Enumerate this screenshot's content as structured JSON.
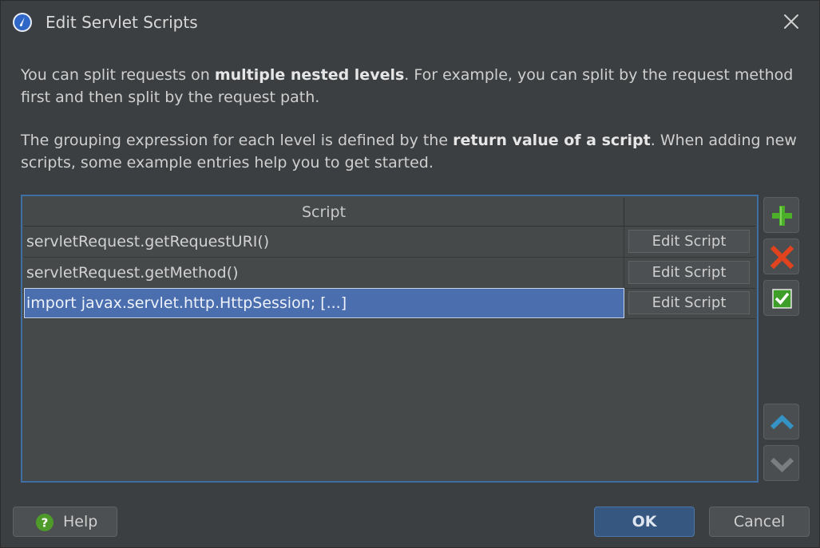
{
  "window": {
    "title": "Edit Servlet Scripts",
    "icon": "compass-icon",
    "close_icon": "close-icon"
  },
  "description": {
    "p1": {
      "pre": "You can split requests on ",
      "bold": "multiple nested levels",
      "post": ". For example, you can split by the request method first and then split by the request path."
    },
    "p2": {
      "pre": "The grouping expression for each level is defined by the ",
      "bold": "return value of a script",
      "post": ". When adding new scripts, some example entries help you to get started."
    }
  },
  "table": {
    "columns": [
      "Script",
      ""
    ],
    "rows": [
      {
        "script": "servletRequest.getRequestURI()",
        "action": "Edit Script",
        "selected": false
      },
      {
        "script": "servletRequest.getMethod()",
        "action": "Edit Script",
        "selected": false
      },
      {
        "script": "import javax.servlet.http.HttpSession; [...]",
        "action": "Edit Script",
        "selected": true
      }
    ]
  },
  "side_buttons": [
    {
      "name": "add",
      "icon": "plus-icon",
      "color": "#4caf2a"
    },
    {
      "name": "remove",
      "icon": "x-icon",
      "color": "#e0431d"
    },
    {
      "name": "check",
      "icon": "checkmark-icon",
      "color": "#3e9e2a"
    },
    {
      "name": "move-up",
      "icon": "chevron-up-icon",
      "color": "#3592c4"
    },
    {
      "name": "move-down",
      "icon": "chevron-down-icon",
      "color": "#7a7e80"
    }
  ],
  "footer": {
    "help_label": "Help",
    "ok_label": "OK",
    "cancel_label": "Cancel"
  },
  "colors": {
    "background": "#3c3f41",
    "selection": "#4b6eaf",
    "focus_border": "#3f6ea3",
    "ok_button": "#365880"
  }
}
